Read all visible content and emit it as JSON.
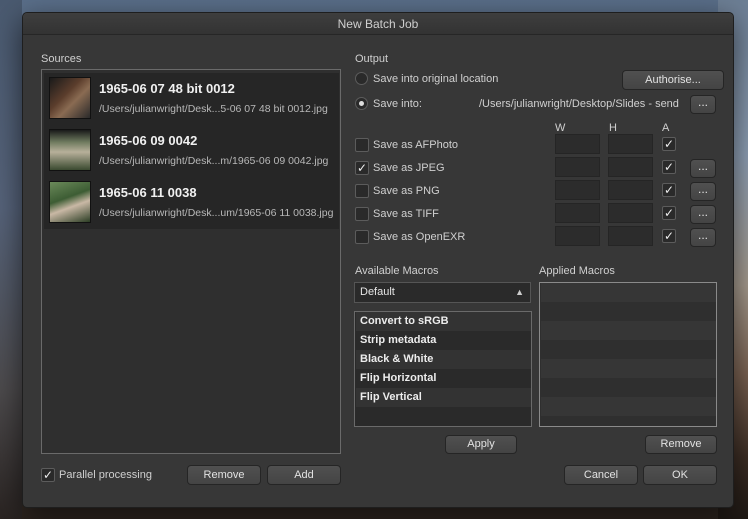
{
  "window": {
    "title": "New Batch Job"
  },
  "sources": {
    "label": "Sources",
    "items": [
      {
        "name": "1965-06 07 48 bit 0012",
        "path": "/Users/julianwright/Desk...5-06 07 48 bit 0012.jpg"
      },
      {
        "name": "1965-06 09 0042",
        "path": "/Users/julianwright/Desk...m/1965-06 09 0042.jpg"
      },
      {
        "name": "1965-06 11 0038",
        "path": "/Users/julianwright/Desk...um/1965-06 11 0038.jpg"
      }
    ],
    "parallel_label": "Parallel processing",
    "remove_label": "Remove",
    "add_label": "Add"
  },
  "output": {
    "label": "Output",
    "original_location_label": "Save into original location",
    "authorise_label": "Authorise...",
    "save_into_label": "Save into:",
    "save_into_path": "/Users/julianwright/Desktop/Slides - send",
    "browse_label": "...",
    "col_w": "W",
    "col_h": "H",
    "col_a": "A",
    "formats": [
      {
        "label": "Save as AFPhoto",
        "checked": false,
        "a_checked": true,
        "has_options": false
      },
      {
        "label": "Save as JPEG",
        "checked": true,
        "a_checked": true,
        "has_options": true
      },
      {
        "label": "Save as PNG",
        "checked": false,
        "a_checked": true,
        "has_options": true
      },
      {
        "label": "Save as TIFF",
        "checked": false,
        "a_checked": true,
        "has_options": true
      },
      {
        "label": "Save as OpenEXR",
        "checked": false,
        "a_checked": true,
        "has_options": true
      }
    ],
    "options_label": "...",
    "check_glyph": "✓"
  },
  "macros": {
    "available_label": "Available Macros",
    "applied_label": "Applied Macros",
    "category": "Default",
    "list": [
      "Convert to sRGB",
      "Strip metadata",
      "Black & White",
      "Flip Horizontal",
      "Flip Vertical"
    ],
    "apply_label": "Apply",
    "remove_label": "Remove"
  },
  "footer": {
    "cancel_label": "Cancel",
    "ok_label": "OK"
  }
}
